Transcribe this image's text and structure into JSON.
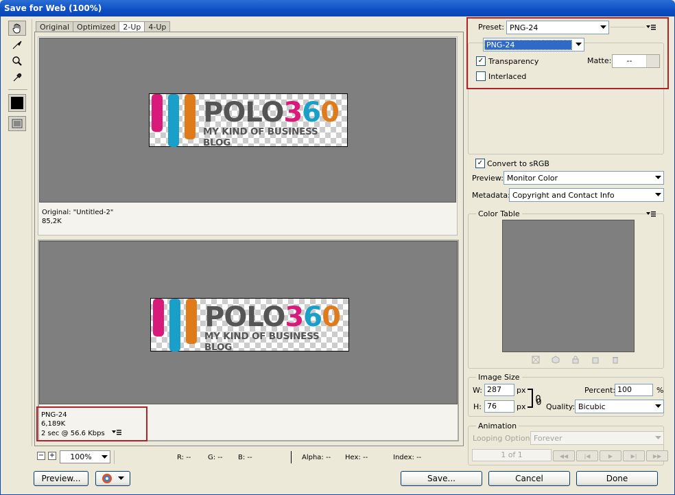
{
  "window": {
    "title": "Save for Web (100%)"
  },
  "tabs": [
    "Original",
    "Optimized",
    "2-Up",
    "4-Up"
  ],
  "logo": {
    "brand_left": "POLO",
    "brand_num": [
      "3",
      "6",
      "0"
    ],
    "tagline": "MY KIND OF BUSINESS BLOG"
  },
  "original_pane": {
    "name": "Original: \"Untitled-2\"",
    "size": "85,2K"
  },
  "optimized_pane": {
    "format": "PNG-24",
    "size": "6,189K",
    "speed": "2 sec @ 56.6 Kbps"
  },
  "statusbar": {
    "zoom": "100%",
    "r": "R: --",
    "g": "G: --",
    "b": "B: --",
    "alpha": "Alpha: --",
    "hex": "Hex: --",
    "index": "Index: --"
  },
  "settings": {
    "preset_label": "Preset:",
    "preset_value": "PNG-24",
    "format_value": "PNG-24",
    "transparency_label": "Transparency",
    "matte_label": "Matte:",
    "matte_value": "--",
    "interlaced_label": "Interlaced",
    "convert_label": "Convert to sRGB",
    "preview_label": "Preview:",
    "preview_value": "Monitor Color",
    "metadata_label": "Metadata:",
    "metadata_value": "Copyright and Contact Info"
  },
  "color_table": {
    "title": "Color Table"
  },
  "image_size": {
    "title": "Image Size",
    "w_label": "W:",
    "w_value": "287",
    "h_label": "H:",
    "h_value": "76",
    "unit": "px",
    "percent_label": "Percent:",
    "percent_value": "100",
    "percent_unit": "%",
    "quality_label": "Quality:",
    "quality_value": "Bicubic"
  },
  "animation": {
    "title": "Animation",
    "looping_label": "Looping Options:",
    "looping_value": "Forever",
    "frame_counter": "1 of 1"
  },
  "buttons": {
    "preview": "Preview...",
    "save": "Save...",
    "cancel": "Cancel",
    "done": "Done"
  },
  "colors": {
    "accent_red": "#b52025",
    "pink": "#d81b7a",
    "blue": "#1aa0c8",
    "orange": "#e07b1a",
    "pane_gray": "#7f7f7f"
  }
}
